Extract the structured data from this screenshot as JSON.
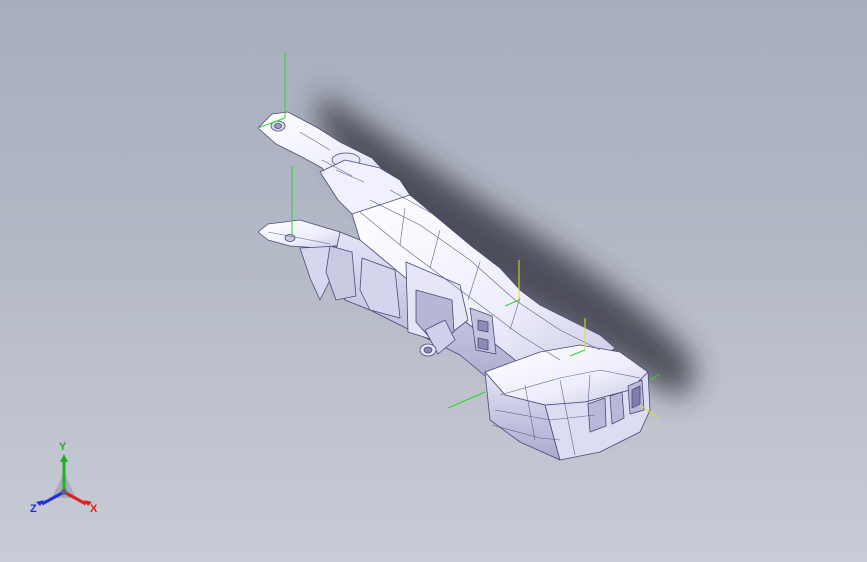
{
  "triad": {
    "labels": {
      "x": "X",
      "y": "Y",
      "z": "Z"
    },
    "colors": {
      "x": "#e02020",
      "y": "#20b020",
      "z": "#2030e0"
    }
  },
  "colors": {
    "background_top": "#a7adbd",
    "background_bottom": "#c8ccd6",
    "part_fill": "#f2f2ff",
    "edge": "#4a4a78",
    "shadow": "#2c2c34",
    "frame_axis_green": "#30d030",
    "frame_axis_yellow": "#e0e020"
  }
}
